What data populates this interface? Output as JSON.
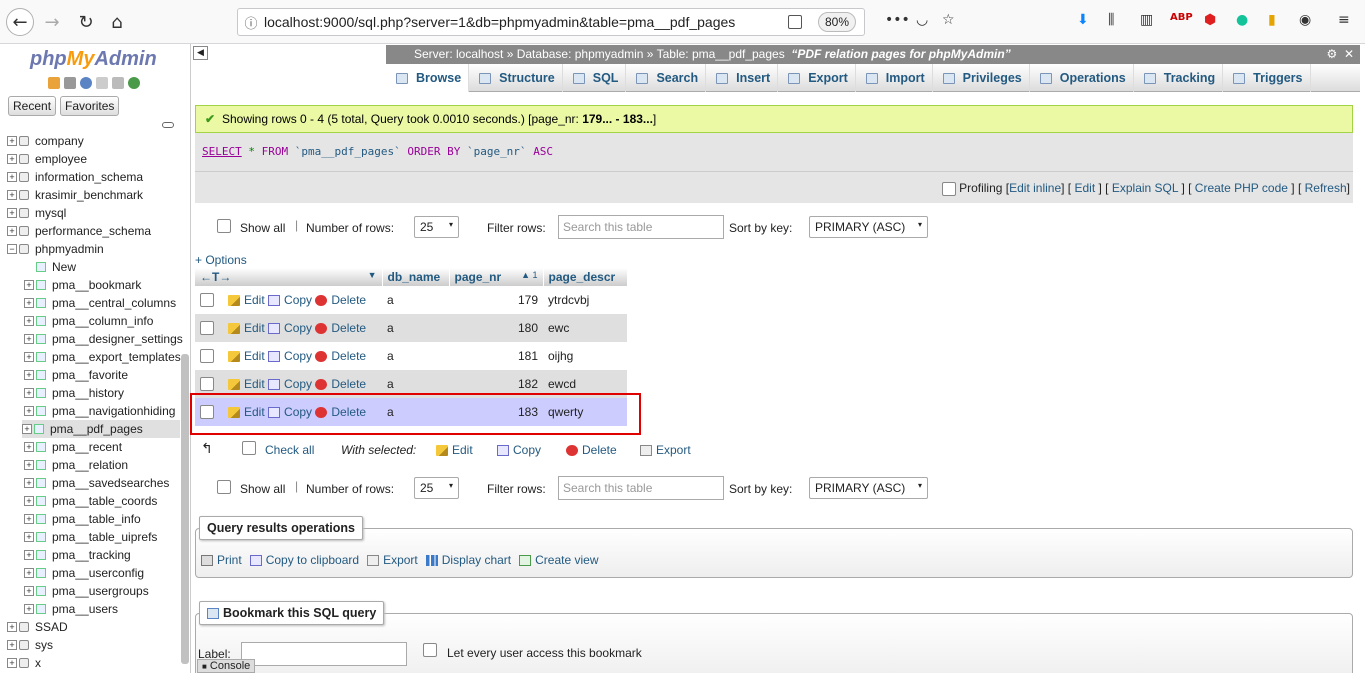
{
  "browser": {
    "url": "localhost:9000/sql.php?server=1&db=phpmyadmin&table=pma__pdf_pages",
    "zoom": "80%"
  },
  "sidebar": {
    "logo": {
      "php": "php",
      "my": "My",
      "admin": "Admin"
    },
    "tabs": [
      "Recent",
      "Favorites"
    ],
    "databases": [
      {
        "name": "company"
      },
      {
        "name": "employee"
      },
      {
        "name": "information_schema"
      },
      {
        "name": "krasimir_benchmark"
      },
      {
        "name": "mysql"
      },
      {
        "name": "performance_schema"
      },
      {
        "name": "phpmyadmin",
        "expanded": true
      }
    ],
    "phpmyadmin_children": [
      "New",
      "pma__bookmark",
      "pma__central_columns",
      "pma__column_info",
      "pma__designer_settings",
      "pma__export_templates",
      "pma__favorite",
      "pma__history",
      "pma__navigationhiding",
      "pma__pdf_pages",
      "pma__recent",
      "pma__relation",
      "pma__savedsearches",
      "pma__table_coords",
      "pma__table_info",
      "pma__table_uiprefs",
      "pma__tracking",
      "pma__userconfig",
      "pma__usergroups",
      "pma__users"
    ],
    "databases_after": [
      "SSAD",
      "sys",
      "x"
    ],
    "selected": "pma__pdf_pages"
  },
  "breadcrumb": {
    "server": "Server: localhost",
    "database": "Database: phpmyadmin",
    "table": "Table: pma__pdf_pages",
    "comment": "“PDF relation pages for phpMyAdmin”"
  },
  "tabs": [
    "Browse",
    "Structure",
    "SQL",
    "Search",
    "Insert",
    "Export",
    "Import",
    "Privileges",
    "Operations",
    "Tracking",
    "Triggers"
  ],
  "success": {
    "text": "Showing rows 0 - 4 (5 total, Query took 0.0010 seconds.) [page_nr: ",
    "range": "179... - 183...",
    "end": "]"
  },
  "sql": {
    "select": "SELECT",
    "star": " * ",
    "from": "FROM",
    "table": " `pma__pdf_pages` ",
    "order": "ORDER BY",
    "col": " `page_nr` ",
    "asc": "ASC"
  },
  "profiling": {
    "label": "Profiling",
    "links": [
      "Edit inline",
      "Edit",
      "Explain SQL",
      "Create PHP code",
      "Refresh"
    ]
  },
  "nav": {
    "show_all": "Show all",
    "num_rows_label": "Number of rows:",
    "num_rows_value": "25",
    "filter_label": "Filter rows:",
    "filter_placeholder": "Search this table",
    "sort_label": "Sort by key:",
    "sort_value": "PRIMARY (ASC)"
  },
  "options_label": "+ Options",
  "table": {
    "columns": [
      "db_name",
      "page_nr",
      "page_descr"
    ],
    "sort_indicator": "▲ 1",
    "actions": {
      "edit": "Edit",
      "copy": "Copy",
      "delete": "Delete"
    },
    "rows": [
      {
        "db_name": "a",
        "page_nr": "179",
        "page_descr": "ytrdcvbj"
      },
      {
        "db_name": "a",
        "page_nr": "180",
        "page_descr": "ewc"
      },
      {
        "db_name": "a",
        "page_nr": "181",
        "page_descr": "oijhg"
      },
      {
        "db_name": "a",
        "page_nr": "182",
        "page_descr": "ewcd"
      },
      {
        "db_name": "a",
        "page_nr": "183",
        "page_descr": "qwerty"
      }
    ]
  },
  "bulk": {
    "check_all": "Check all",
    "with_selected": "With selected:",
    "edit": "Edit",
    "copy": "Copy",
    "delete": "Delete",
    "export": "Export"
  },
  "qro": {
    "legend": "Query results operations",
    "links": [
      "Print",
      "Copy to clipboard",
      "Export",
      "Display chart",
      "Create view"
    ]
  },
  "bookmark": {
    "legend": "Bookmark this SQL query",
    "label": "Label:",
    "access_label": "Let every user access this bookmark"
  },
  "console": "Console"
}
